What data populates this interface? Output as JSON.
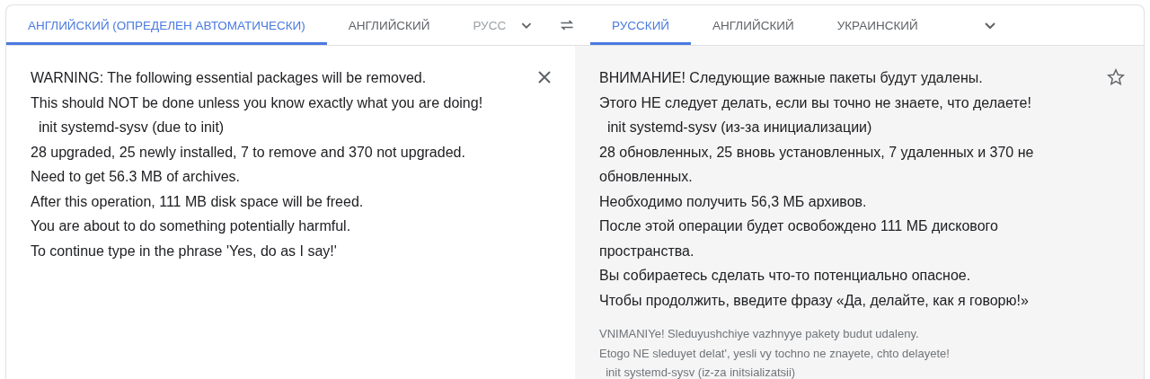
{
  "source_tabs": [
    {
      "label": "АНГЛИЙСКИЙ (ОПРЕДЕЛЕН АВТОМАТИЧЕСКИ)",
      "selected": true
    },
    {
      "label": "АНГЛИЙСКИЙ",
      "selected": false
    },
    {
      "label": "РУСС",
      "selected": false
    }
  ],
  "target_tabs": [
    {
      "label": "РУССКИЙ",
      "selected": true
    },
    {
      "label": "АНГЛИЙСКИЙ",
      "selected": false
    },
    {
      "label": "УКРАИНСКИЙ",
      "selected": false
    }
  ],
  "source_text": [
    "WARNING: The following essential packages will be removed.",
    "This should NOT be done unless you know exactly what you are doing!",
    "  init systemd-sysv (due to init)",
    "28 upgraded, 25 newly installed, 7 to remove and 370 not upgraded.",
    "Need to get 56.3 MB of archives.",
    "After this operation, 111 MB disk space will be freed.",
    "You are about to do something potentially harmful.",
    "To continue type in the phrase 'Yes, do as I say!'"
  ],
  "translation": [
    "ВНИМАНИЕ! Следующие важные пакеты будут удалены.",
    "Этого НЕ следует делать, если вы точно не знаете, что делаете!",
    "  init systemd-sysv (из-за инициализации)",
    "28 обновленных, 25 вновь установленных, 7 удаленных и 370 не обновленных.",
    "Необходимо получить 56,3 МБ архивов.",
    "После этой операции будет освобождено 111 МБ дискового пространства.",
    "Вы собираетесь сделать что-то потенциально опасное.",
    "Чтобы продолжить, введите фразу «Да, делайте, как я говорю!»"
  ],
  "transliteration": [
    "VNIMANIYe! Sleduyushchiye vazhnyye pakety budut udaleny.",
    "Etogo NE sleduyet delat', yesli vy tochno ne znayete, chto delayete!",
    "  init systemd-sysv (iz-za initsializatsii)"
  ]
}
